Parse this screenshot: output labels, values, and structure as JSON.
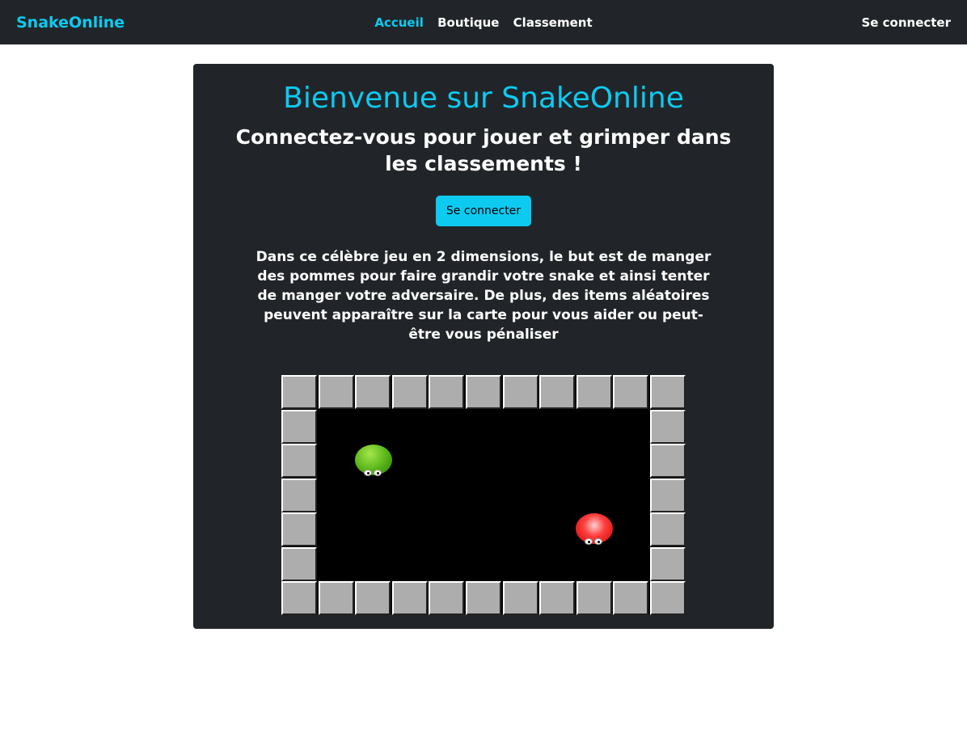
{
  "nav": {
    "brand": "SnakeOnline",
    "links": [
      {
        "label": "Accueil",
        "active": true
      },
      {
        "label": "Boutique",
        "active": false
      },
      {
        "label": "Classement",
        "active": false
      }
    ],
    "login": "Se connecter"
  },
  "hero": {
    "title": "Bienvenue sur SnakeOnline",
    "subtitle": "Connectez-vous pour jouer et grimper dans les classements !",
    "button": "Se connecter",
    "description": "Dans ce célèbre jeu en 2 dimensions, le but est de manger des pommes pour faire grandir votre snake et ainsi tenter de manger votre adversaire. De plus, des items aléatoires peuvent apparaître sur la carte pour vous aider ou peut-être vous pénaliser"
  },
  "game_preview": {
    "wall_color": "#adadad",
    "background_color": "#000000",
    "snakes": [
      {
        "color": "green",
        "icon": "green-snake-head-icon"
      },
      {
        "color": "red",
        "icon": "red-snake-head-icon"
      }
    ]
  },
  "colors": {
    "accent": "#0dcaf0",
    "nav_bg": "#212529",
    "card_bg": "#212529"
  }
}
